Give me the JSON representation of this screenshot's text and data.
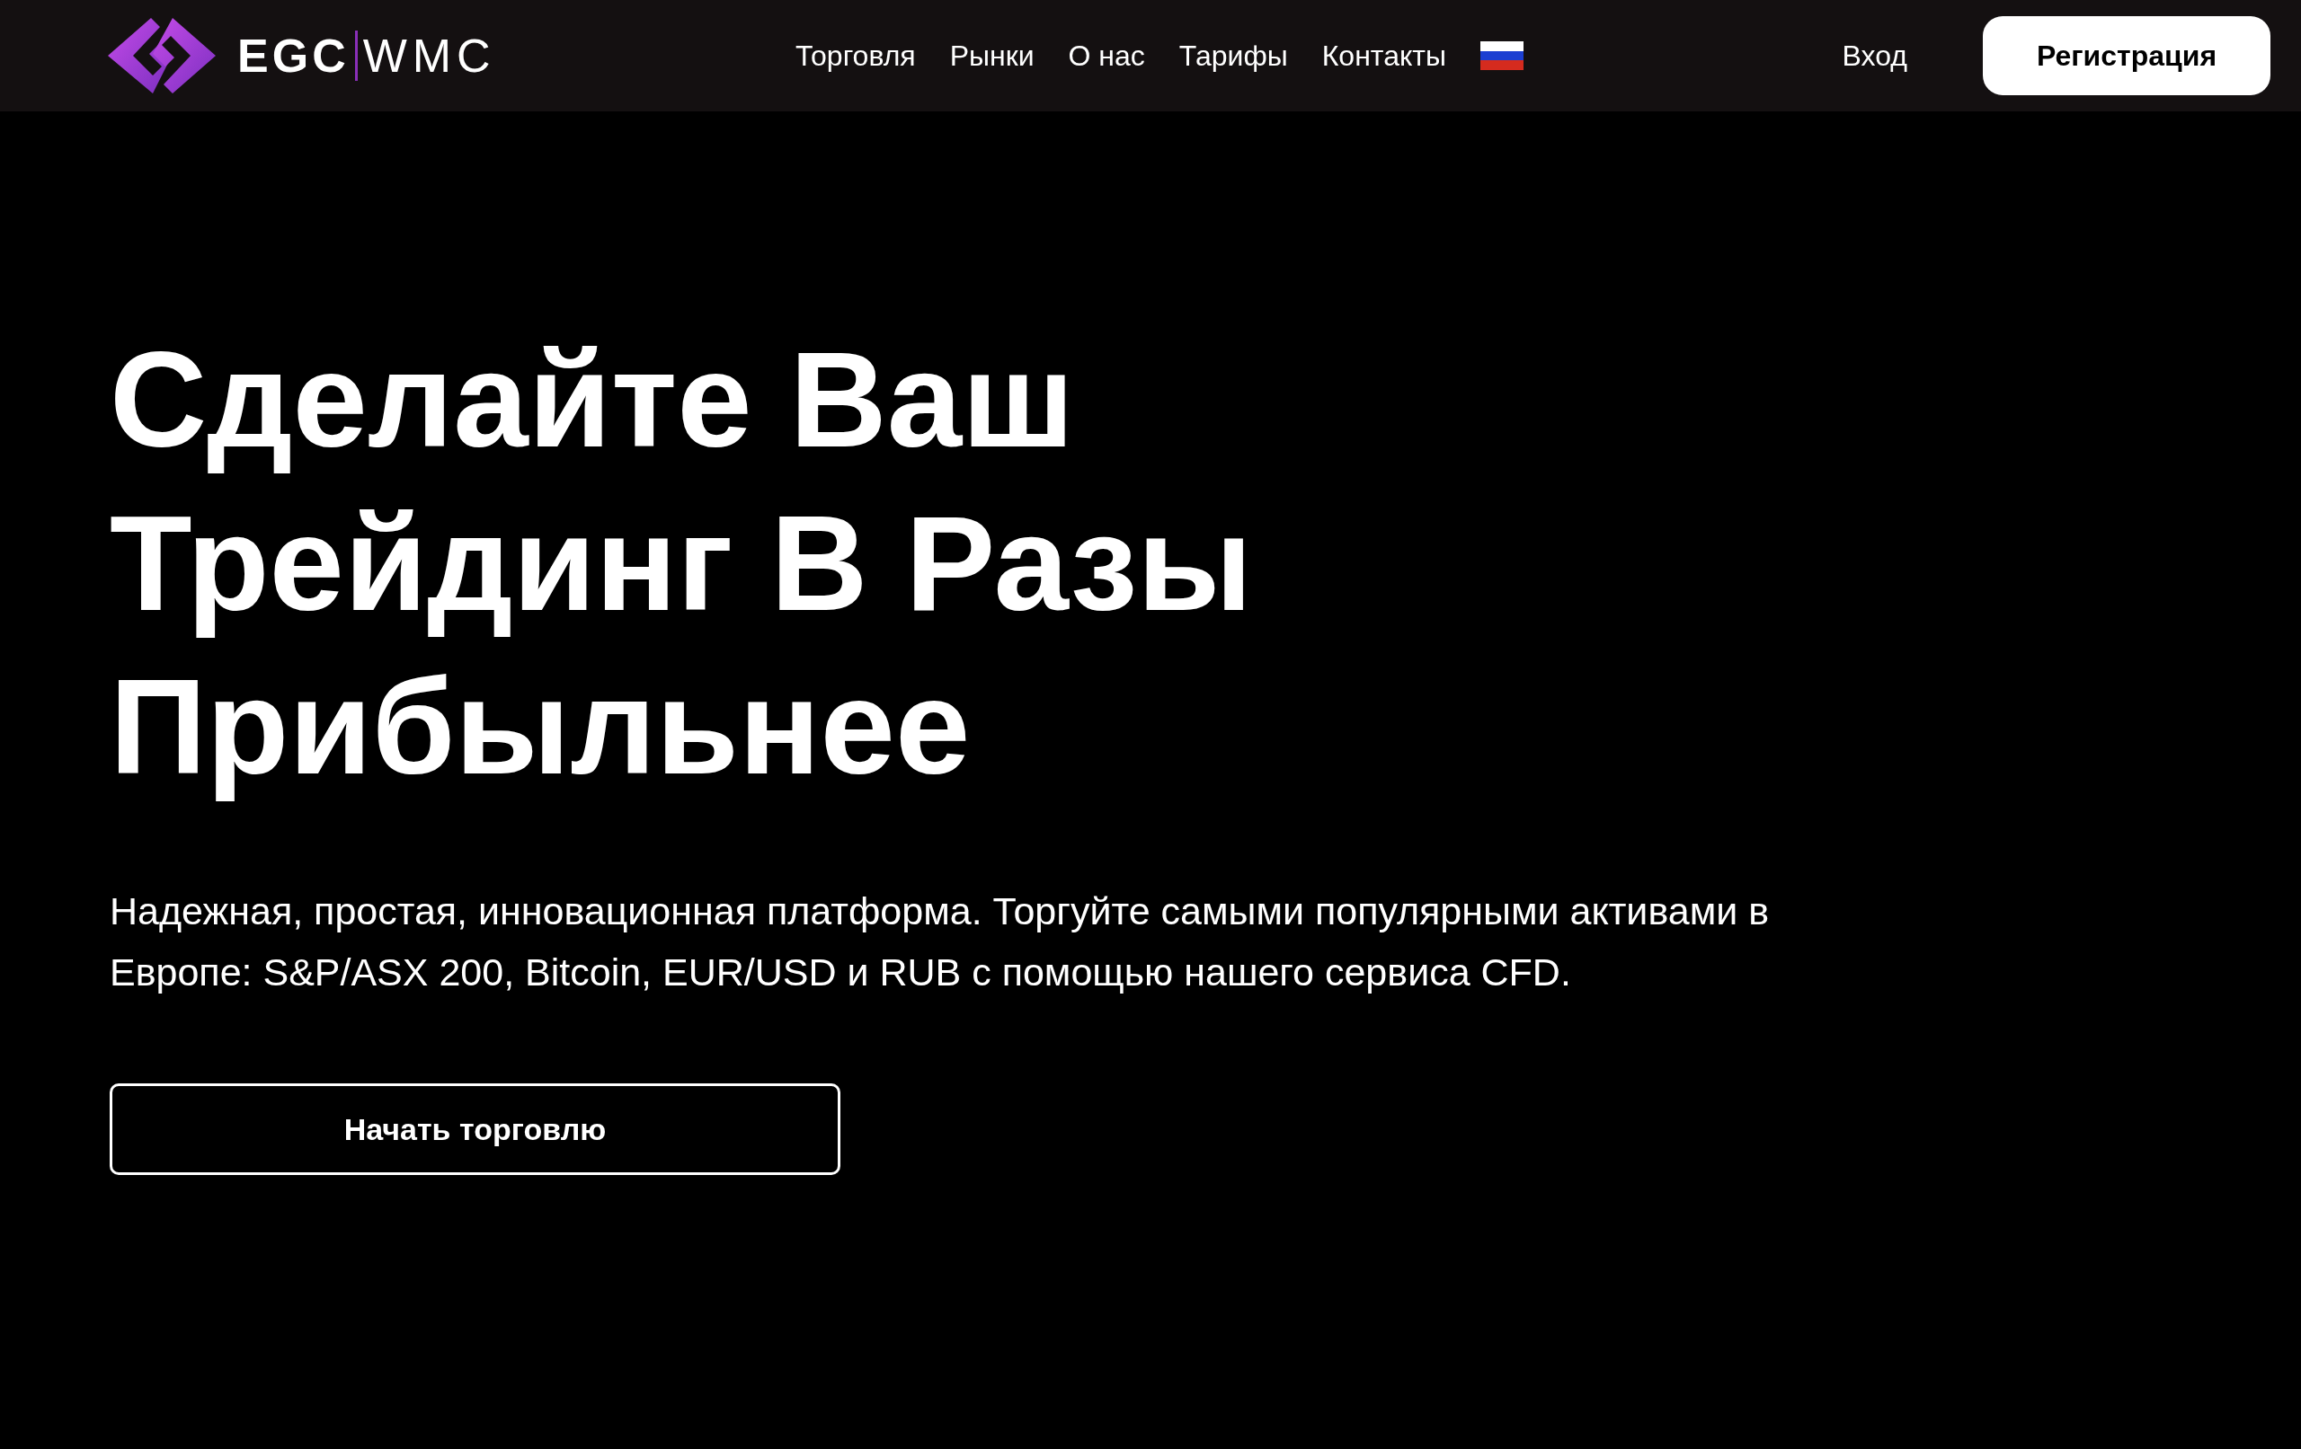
{
  "header": {
    "logo": {
      "left": "EGC",
      "right": "WMC"
    },
    "nav": [
      {
        "label": "Торговля"
      },
      {
        "label": "Рынки"
      },
      {
        "label": "О нас"
      },
      {
        "label": "Тарифы"
      },
      {
        "label": "Контакты"
      }
    ],
    "login": "Вход",
    "register": "Регистрация"
  },
  "hero": {
    "title": "Сделайте Ваш Трейдинг В Разы Прибыльнее",
    "description": "Надежная, простая, инновационная платформа. Торгуйте самыми популярными активами в Европе: S&P/ASX 200, Bitcoin, EUR/USD и RUB с помощью нашего сервиса CFD.",
    "cta": "Начать торговлю"
  }
}
